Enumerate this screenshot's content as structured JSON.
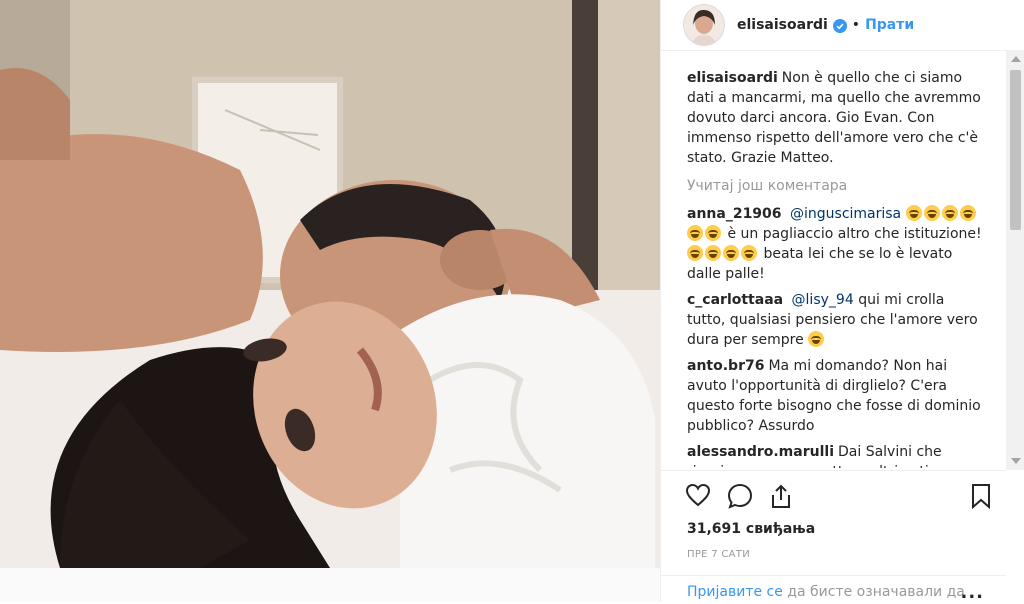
{
  "post": {
    "username": "elisaisoardi",
    "follow_label": "Прати",
    "dot": "•"
  },
  "caption": {
    "user": "elisaisoardi",
    "text": "Non è quello che ci siamo dati a mancarmi, ma quello che avremmo dovuto darci ancora. Gio Evan. Con immenso rispetto dell'amore vero che c'è stato. Grazie Matteo."
  },
  "load_more_label": "Учитај још коментара",
  "comments": [
    {
      "user": "anna_21906",
      "mention": "@inguscimarisa",
      "text_a": "è un pagliaccio altro che istituzione!",
      "text_b": "beata lei che se lo è levato dalle palle!"
    },
    {
      "user": "c_carlottaaa",
      "mention": "@lisy_94",
      "text": "qui mi crolla tutto, qualsiasi pensiero che l'amore vero dura per sempre"
    },
    {
      "user": "anto.br76",
      "text": "Ma mi domando? Non hai avuto l'opportunità di dirglielo? C'era questo forte bisogno che fosse di dominio pubblico? Assurdo"
    },
    {
      "user": "alessandro.marulli",
      "text": "Dai Salvini che riesci ancora a raccattare altri voti sfruttando"
    }
  ],
  "likes_label": "31,691 свиђања",
  "time_label": "Пре 7 сати",
  "login": {
    "link": "Пријавите се",
    "text": "да бисте означавали да",
    "more": "..."
  },
  "icons": {
    "like": "heart-icon",
    "comment": "comment-bubble-icon",
    "share": "share-icon",
    "save": "bookmark-icon",
    "verified": "verified-badge-icon"
  },
  "colors": {
    "link": "#3897f0",
    "mention": "#003569",
    "muted": "#999999",
    "text": "#262626"
  }
}
